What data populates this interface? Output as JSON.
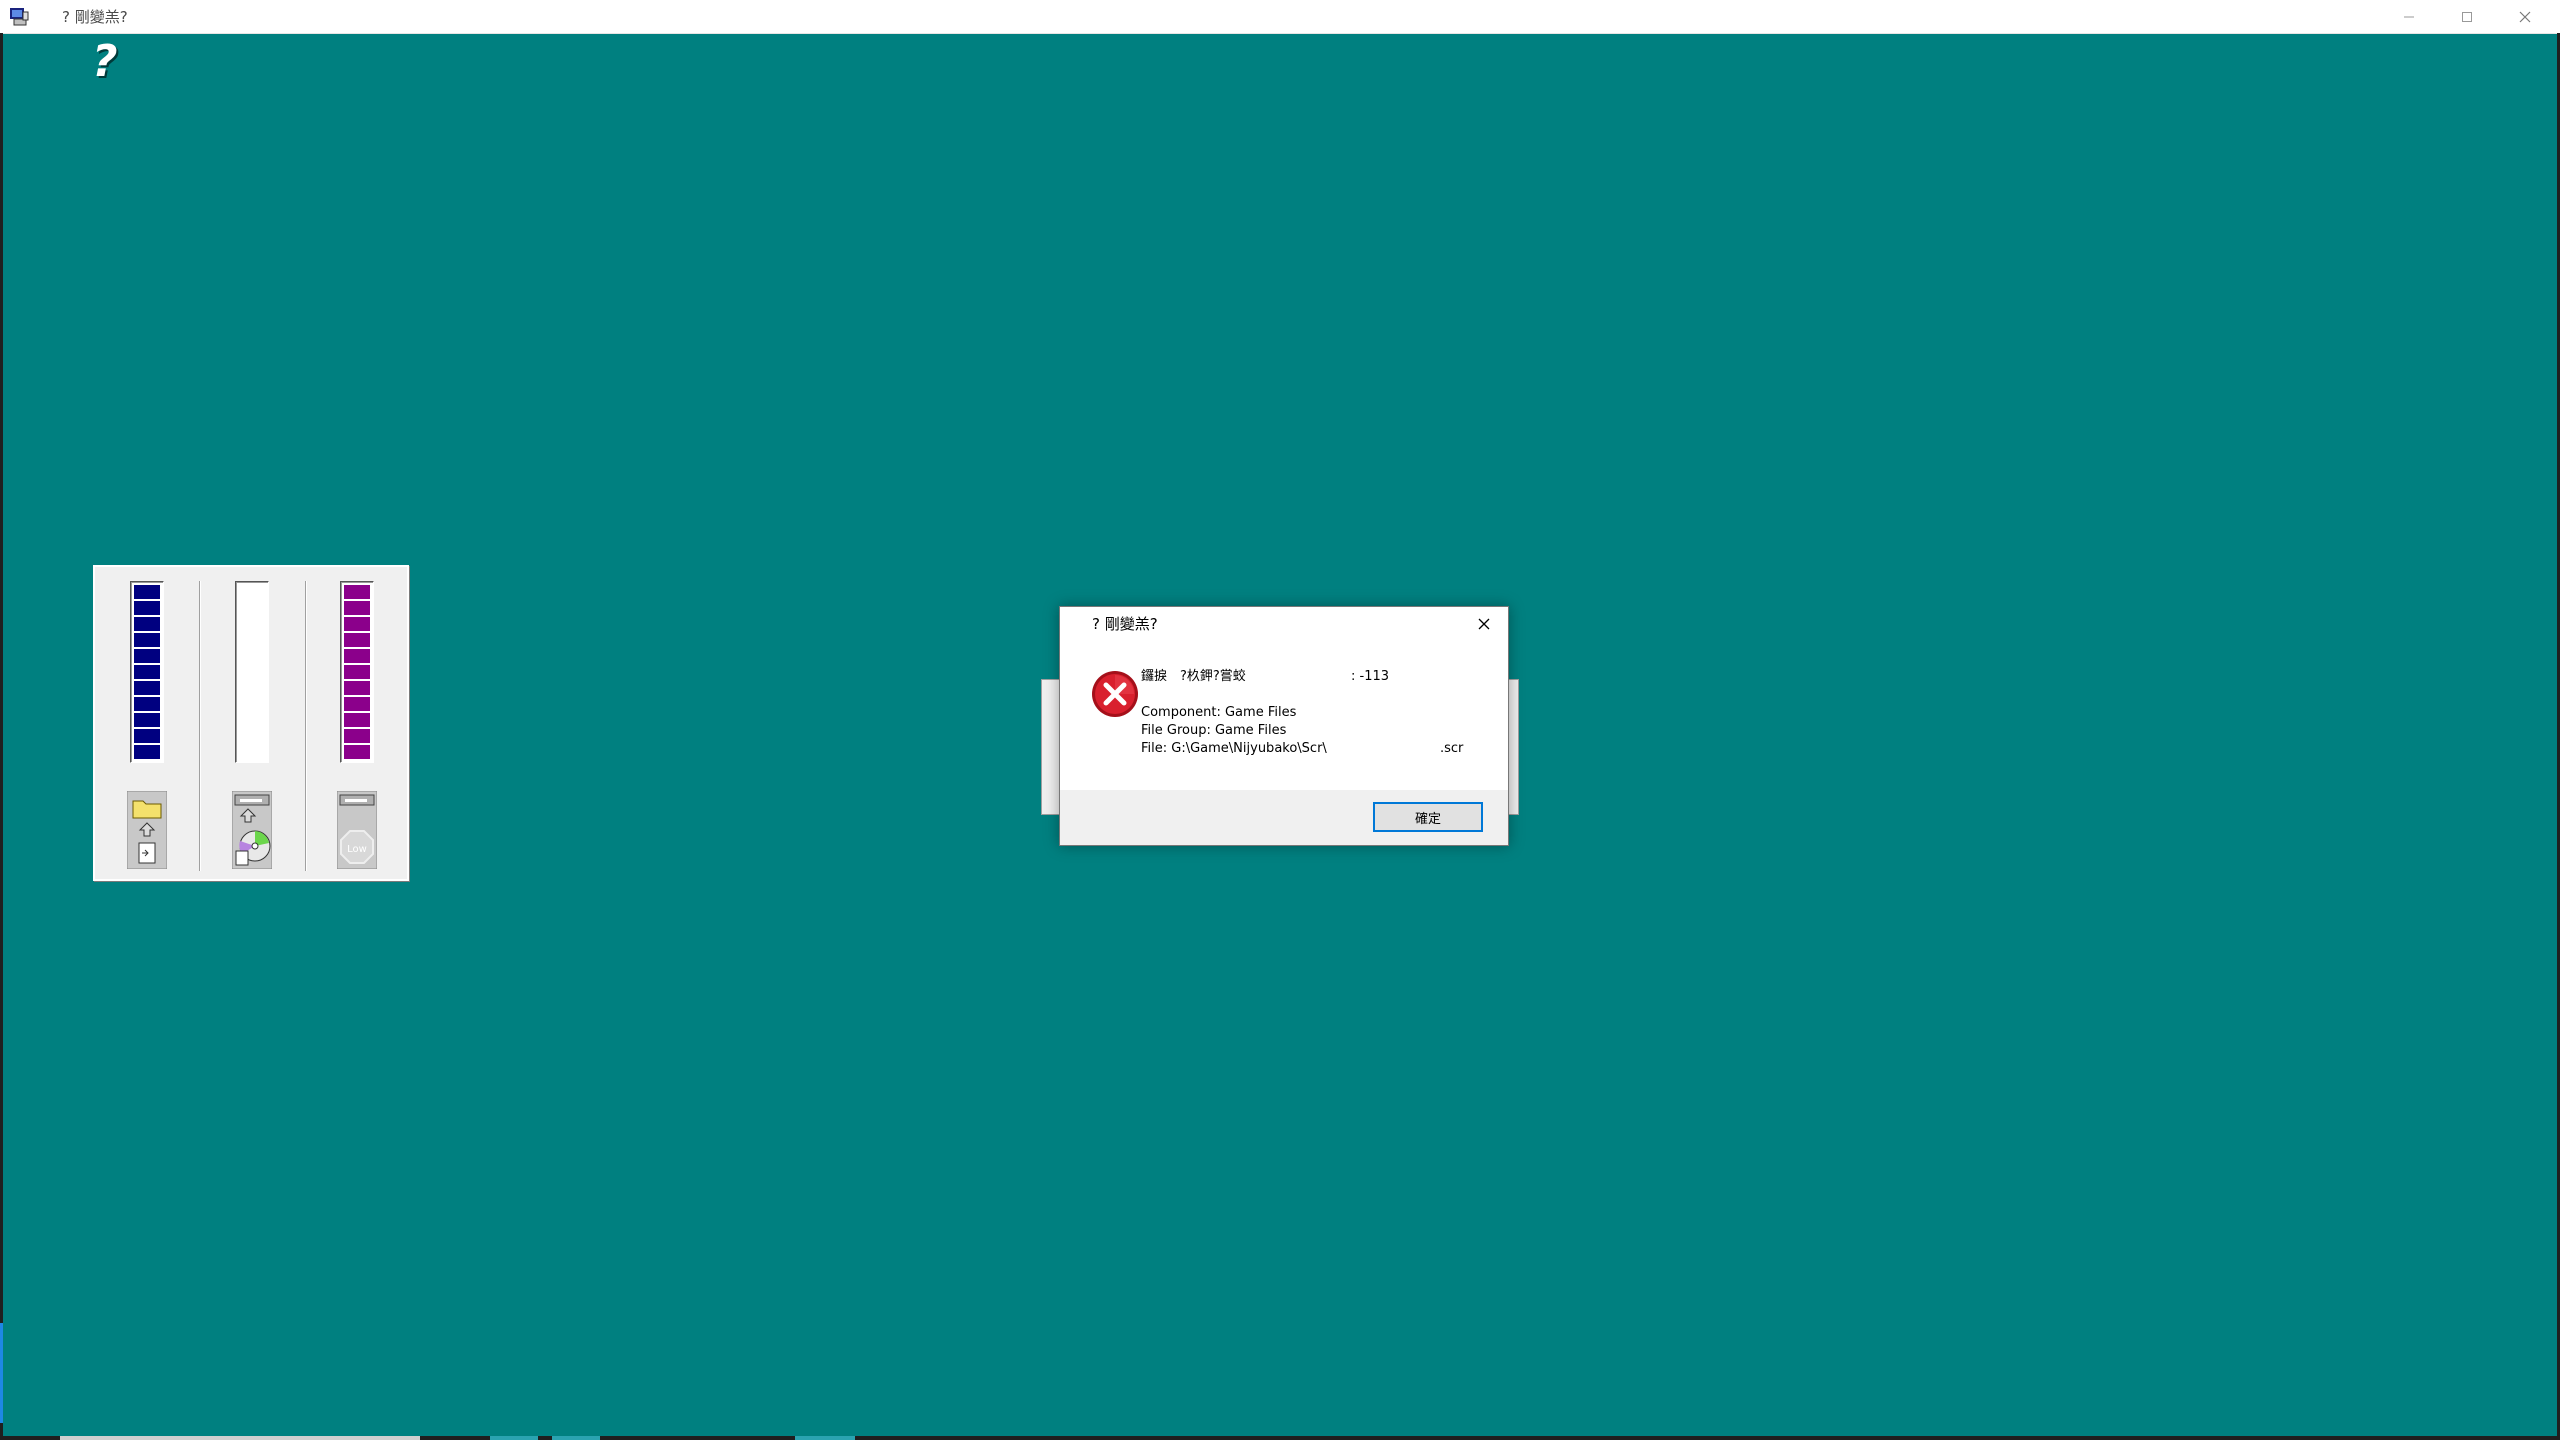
{
  "window": {
    "title": "? 剛變羔?",
    "app_icon": "setup-monitor-icon",
    "controls": [
      "minimize-icon",
      "maximize-icon",
      "close-icon"
    ],
    "background_color": "#008080"
  },
  "help_glyph": "?",
  "meters": [
    {
      "name": "file-progress",
      "level": 1.0,
      "color": "#000080",
      "icon": "folder-copy-icon"
    },
    {
      "name": "disk-progress",
      "level": 0.0,
      "color": "#ffffff",
      "icon": "disk-cd-icon"
    },
    {
      "name": "memory-meter",
      "level": 1.0,
      "color": "#8b008b",
      "icon": "low-memory-icon",
      "icon_label": "Low"
    }
  ],
  "error_dialog": {
    "title": "? 剛變羔?",
    "icon": "error-x-icon",
    "message_line1": "鑼捩　?杦鉀?嘗蛟",
    "error_code": ": -113",
    "component": "Component: Game Files",
    "file_group": "File Group: Game Files",
    "file_path": "File: G:\\Game\\Nijyubako\\Scr\\",
    "file_ext": ".scr",
    "ok_label": "確定"
  }
}
